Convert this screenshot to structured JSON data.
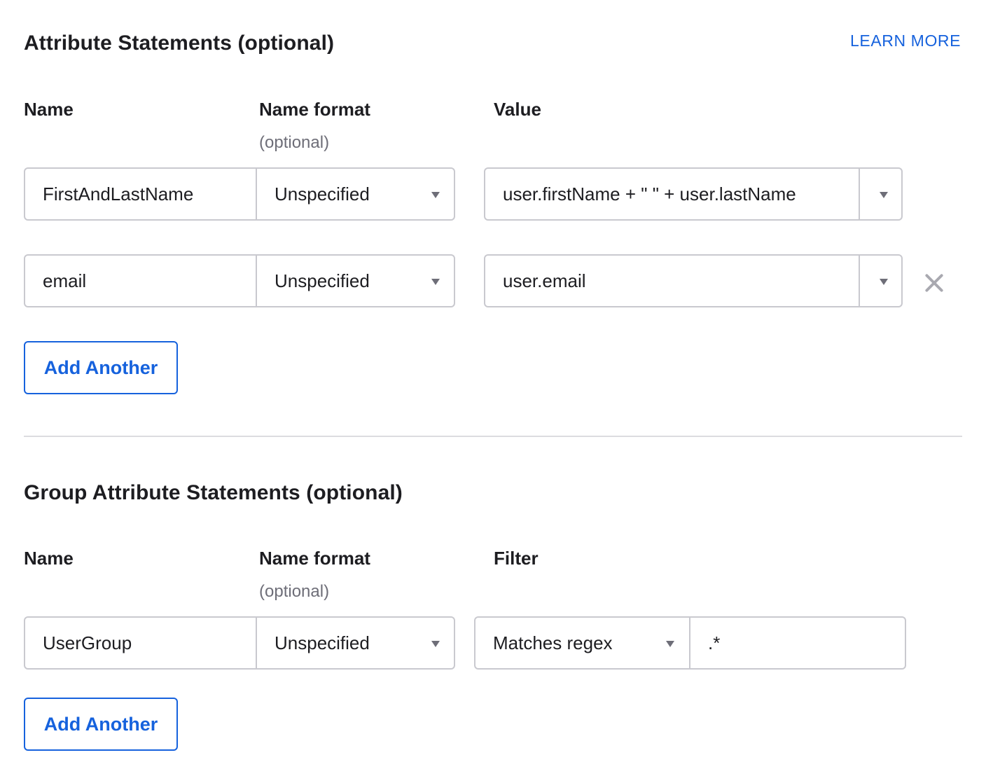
{
  "attribute_statements": {
    "title": "Attribute Statements (optional)",
    "learn_more": "LEARN MORE",
    "columns": {
      "name": "Name",
      "name_format": "Name format",
      "name_format_hint": "(optional)",
      "value": "Value"
    },
    "rows": [
      {
        "name": "FirstAndLastName",
        "name_format": "Unspecified",
        "value": "user.firstName + \" \" + user.lastName"
      },
      {
        "name": "email",
        "name_format": "Unspecified",
        "value": "user.email"
      }
    ],
    "add_button": "Add Another"
  },
  "group_attribute_statements": {
    "title": "Group Attribute Statements (optional)",
    "columns": {
      "name": "Name",
      "name_format": "Name format",
      "name_format_hint": "(optional)",
      "filter": "Filter"
    },
    "rows": [
      {
        "name": "UserGroup",
        "name_format": "Unspecified",
        "filter_type": "Matches regex",
        "filter_value": ".*"
      }
    ],
    "add_button": "Add Another"
  },
  "icons": {
    "dropdown": "caret-down-icon",
    "remove": "close-icon"
  },
  "colors": {
    "accent": "#1662dd",
    "border": "#c9c9cf",
    "text": "#1d1d21",
    "muted": "#6e6e78"
  }
}
